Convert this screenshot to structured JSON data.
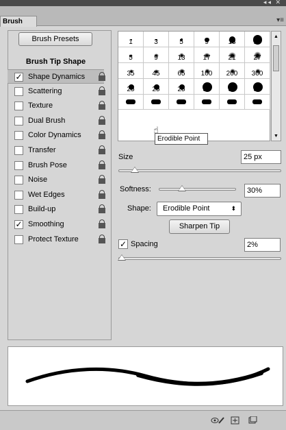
{
  "window": {
    "collapse_icon": "double-chevron",
    "close_icon": "close-x"
  },
  "tab": {
    "title": "Brush"
  },
  "left": {
    "presets_button": "Brush Presets",
    "tip_shape": "Brush Tip Shape",
    "options": [
      {
        "label": "Shape Dynamics",
        "checked": true,
        "selected": true
      },
      {
        "label": "Scattering",
        "checked": false
      },
      {
        "label": "Texture",
        "checked": false
      },
      {
        "label": "Dual Brush",
        "checked": false
      },
      {
        "label": "Color Dynamics",
        "checked": false
      },
      {
        "label": "Transfer",
        "checked": false
      },
      {
        "label": "Brush Pose",
        "checked": false
      },
      {
        "label": "Noise",
        "checked": false
      },
      {
        "label": "Wet Edges",
        "checked": false
      },
      {
        "label": "Build-up",
        "checked": false
      },
      {
        "label": "Smoothing",
        "checked": true
      },
      {
        "label": "Protect Texture",
        "checked": false
      }
    ]
  },
  "grid": {
    "rows": [
      [
        "1",
        "3",
        "5",
        "9",
        "13",
        "19"
      ],
      [
        "5",
        "9",
        "13",
        "17",
        "21",
        "27"
      ],
      [
        "35",
        "45",
        "65",
        "100",
        "200",
        "300"
      ],
      [
        "25",
        "25",
        "25",
        "30",
        "30",
        "30"
      ]
    ]
  },
  "tooltip": "Erodible Point",
  "size": {
    "label": "Size",
    "value": "25 px",
    "slider_fraction": 0.1
  },
  "softness": {
    "label": "Softness:",
    "value": "30%",
    "slider_fraction": 0.3
  },
  "shape": {
    "label": "Shape:",
    "selected": "Erodible Point"
  },
  "sharpen_button": "Sharpen Tip",
  "spacing": {
    "label": "Spacing",
    "checked": true,
    "value": "2%",
    "slider_fraction": 0.02
  }
}
